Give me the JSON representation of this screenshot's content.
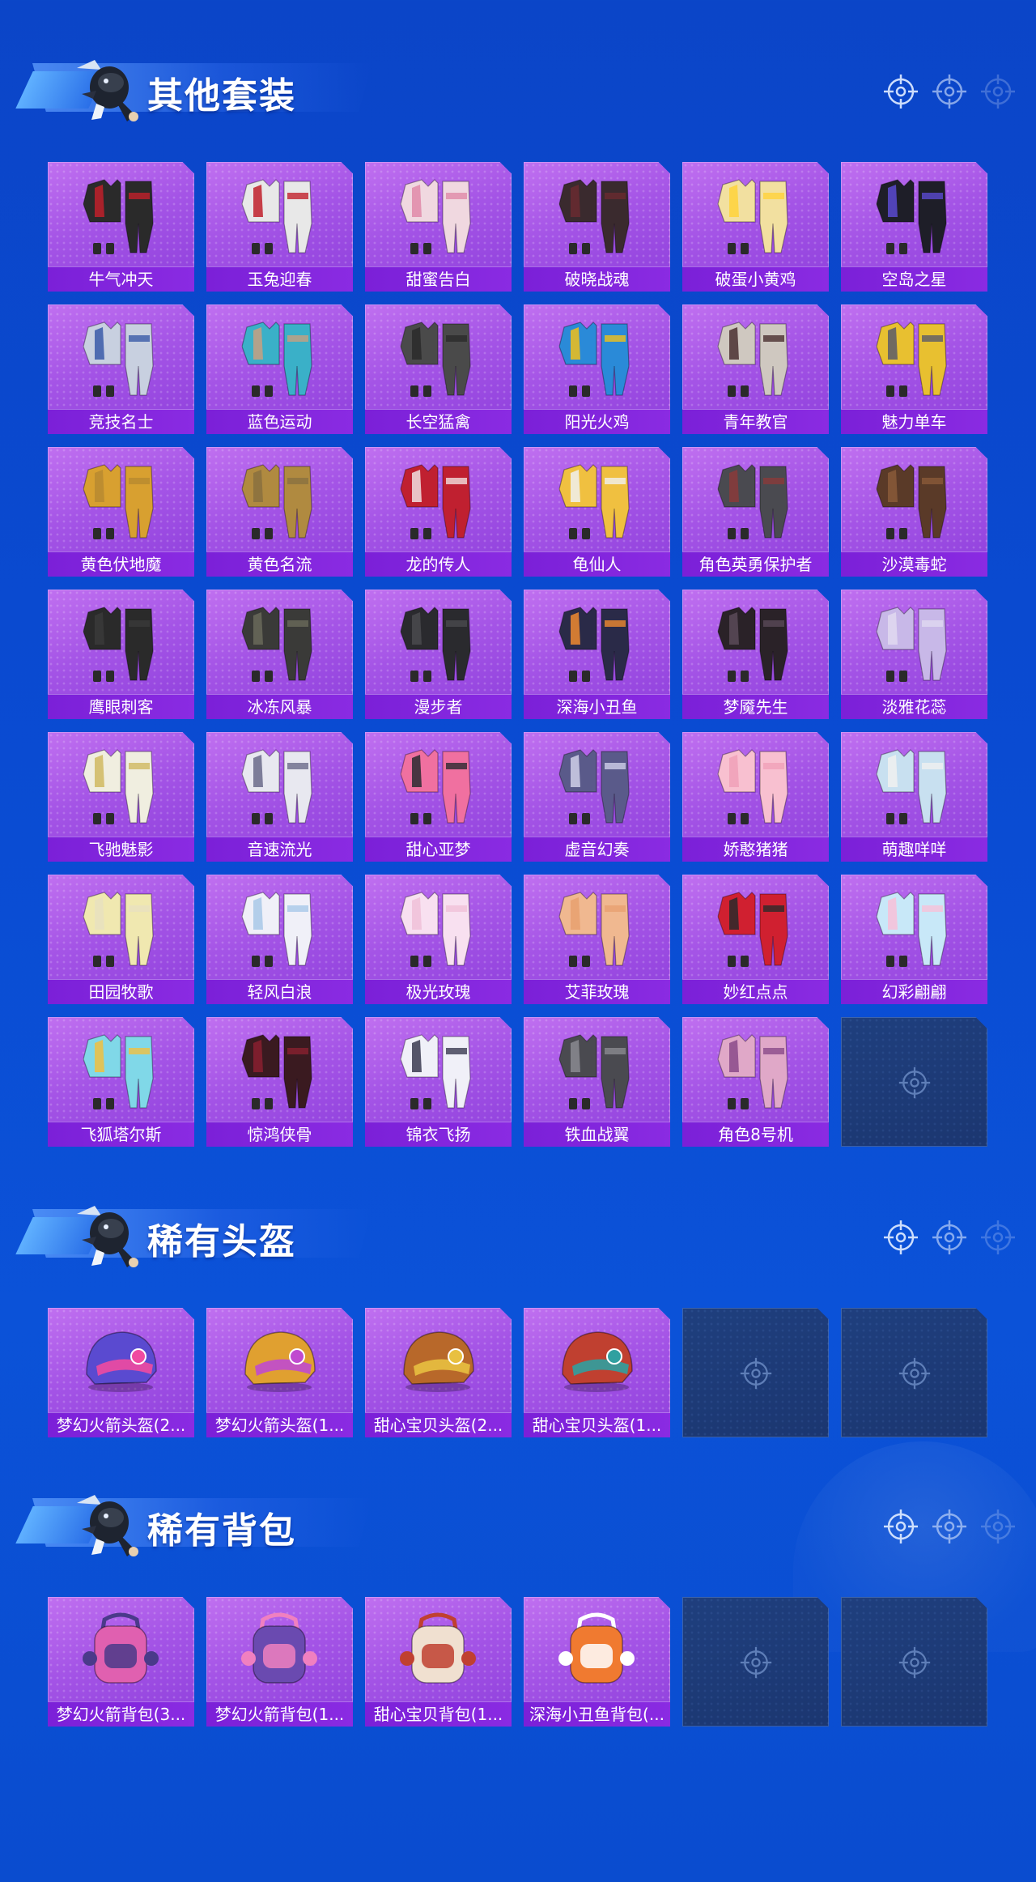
{
  "sections": [
    {
      "title": "其他套装",
      "items": [
        {
          "label": "牛气冲天",
          "color": "#2a2a2a",
          "accent": "#c0202a"
        },
        {
          "label": "玉兔迎春",
          "color": "#e8e8e8",
          "accent": "#c0202a"
        },
        {
          "label": "甜蜜告白",
          "color": "#f0d8e0",
          "accent": "#e08aa8"
        },
        {
          "label": "破晓战魂",
          "color": "#3a2a2e",
          "accent": "#6a2a30"
        },
        {
          "label": "破蛋小黄鸡",
          "color": "#f2e0a0",
          "accent": "#ffd23a"
        },
        {
          "label": "空岛之星",
          "color": "#1e1e28",
          "accent": "#5a4ad0"
        },
        {
          "label": "竞技名士",
          "color": "#c8d0e0",
          "accent": "#3a5aa8"
        },
        {
          "label": "蓝色运动",
          "color": "#3ab0c8",
          "accent": "#c8a080"
        },
        {
          "label": "长空猛禽",
          "color": "#4a4a4a",
          "accent": "#2a2a2a"
        },
        {
          "label": "阳光火鸡",
          "color": "#2a8ad8",
          "accent": "#f2c018"
        },
        {
          "label": "青年教官",
          "color": "#cfc8c0",
          "accent": "#4a3030"
        },
        {
          "label": "魅力单车",
          "color": "#e8c030",
          "accent": "#5a5a6a"
        },
        {
          "label": "黄色伏地魔",
          "color": "#d8a030",
          "accent": "#b88a30"
        },
        {
          "label": "黄色名流",
          "color": "#b08a40",
          "accent": "#8a7040"
        },
        {
          "label": "龙的传人",
          "color": "#c02030",
          "accent": "#f0e0e0"
        },
        {
          "label": "龟仙人",
          "color": "#f0c040",
          "accent": "#f0f0f0"
        },
        {
          "label": "角色英勇保护者",
          "color": "#4a4a50",
          "accent": "#8a3a3a"
        },
        {
          "label": "沙漠毒蛇",
          "color": "#5a3a28",
          "accent": "#8a5a38"
        },
        {
          "label": "鹰眼刺客",
          "color": "#2a2a2a",
          "accent": "#3a3a3a"
        },
        {
          "label": "冰冻风暴",
          "color": "#3a3a38",
          "accent": "#6a6a5a"
        },
        {
          "label": "漫步者",
          "color": "#2a2a2e",
          "accent": "#4a4a4e"
        },
        {
          "label": "深海小丑鱼",
          "color": "#2a2a48",
          "accent": "#f08a30"
        },
        {
          "label": "梦魇先生",
          "color": "#2a2228",
          "accent": "#5a4a58"
        },
        {
          "label": "淡雅花蕊",
          "color": "#c8b8e8",
          "accent": "#e0d8f0"
        },
        {
          "label": "飞驰魅影",
          "color": "#f0eee0",
          "accent": "#d0b860"
        },
        {
          "label": "音速流光",
          "color": "#e8e8f0",
          "accent": "#6a6a8a"
        },
        {
          "label": "甜心亚梦",
          "color": "#f070a0",
          "accent": "#2a2a30"
        },
        {
          "label": "虚音幻奏",
          "color": "#5a5a8a",
          "accent": "#d0d0e8"
        },
        {
          "label": "娇憨猪猪",
          "color": "#f8c0d0",
          "accent": "#f0a0b8"
        },
        {
          "label": "萌趣咩咩",
          "color": "#c8e0f0",
          "accent": "#f0f0f0"
        },
        {
          "label": "田园牧歌",
          "color": "#f0e8b0",
          "accent": "#e8e0c0"
        },
        {
          "label": "轻风白浪",
          "color": "#f0f0f8",
          "accent": "#a8c8e8"
        },
        {
          "label": "极光玫瑰",
          "color": "#f8e0f0",
          "accent": "#f0c0d8"
        },
        {
          "label": "艾菲玫瑰",
          "color": "#f0b890",
          "accent": "#e8a070"
        },
        {
          "label": "妙红点点",
          "color": "#d02030",
          "accent": "#2a2a2a"
        },
        {
          "label": "幻彩翩翩",
          "color": "#c8e8f8",
          "accent": "#f8c0d8"
        },
        {
          "label": "飞狐塔尔斯",
          "color": "#80d8e8",
          "accent": "#f0c040"
        },
        {
          "label": "惊鸿侠骨",
          "color": "#3a1a20",
          "accent": "#8a2030"
        },
        {
          "label": "锦衣飞扬",
          "color": "#f0f0f8",
          "accent": "#3a3a50"
        },
        {
          "label": "铁血战翼",
          "color": "#4a4a50",
          "accent": "#8a8a90"
        },
        {
          "label": "角色8号机",
          "color": "#e0a8c8",
          "accent": "#8a4a8a"
        }
      ],
      "empty_slots": 1
    },
    {
      "title": "稀有头盔",
      "items": [
        {
          "label": "梦幻火箭头盔(2...",
          "color": "#5a4ad0",
          "accent": "#f04aa0"
        },
        {
          "label": "梦幻火箭头盔(1...",
          "color": "#e0a030",
          "accent": "#c04ad0"
        },
        {
          "label": "甜心宝贝头盔(2...",
          "color": "#b8682a",
          "accent": "#e8c040"
        },
        {
          "label": "甜心宝贝头盔(1...",
          "color": "#c04030",
          "accent": "#30a0a0"
        }
      ],
      "empty_slots": 2
    },
    {
      "title": "稀有背包",
      "items": [
        {
          "label": "梦幻火箭背包(3...",
          "color": "#e060b0",
          "accent": "#4a3a8a"
        },
        {
          "label": "梦幻火箭背包(1...",
          "color": "#6a4ab0",
          "accent": "#f080c0"
        },
        {
          "label": "甜心宝贝背包(1...",
          "color": "#f0e0d0",
          "accent": "#c04030"
        },
        {
          "label": "深海小丑鱼背包(...",
          "color": "#f07a30",
          "accent": "#ffffff"
        }
      ],
      "empty_slots": 2
    }
  ],
  "icons": {
    "target": "crosshair-target-icon",
    "mascot": "mascot-character-icon",
    "empty_slot": "crosshair-target-icon"
  },
  "colors": {
    "background": "#0b4acd",
    "card": "#a454e6",
    "label_bar": "#8a2be2",
    "empty_slot": "#1f3f7e"
  }
}
